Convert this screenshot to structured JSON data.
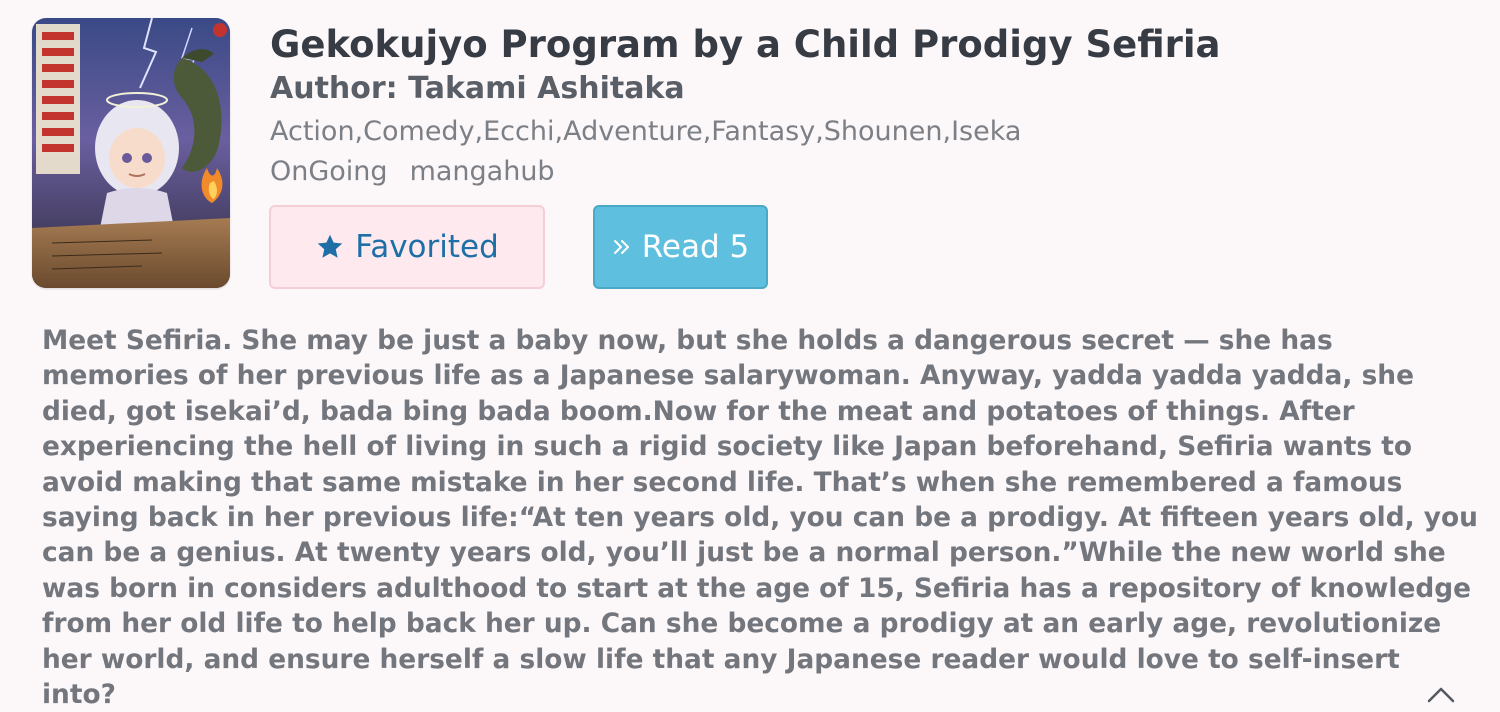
{
  "manga": {
    "title": "Gekokujyo Program by a Child Prodigy Sefiria",
    "author": "Author: Takami Ashitaka",
    "genres": "Action,Comedy,Ecchi,Adventure,Fantasy,Shounen,Iseka",
    "status": "OnGoing",
    "source": "mangahub",
    "cover_icon": "manga-cover-art"
  },
  "actions": {
    "favorite_label": "Favorited",
    "favorite_icon": "star-icon",
    "read_label": "Read 5",
    "read_icon": "double-chevron-right-icon"
  },
  "description": "Meet Sefiria. She may be just a baby now, but she holds a dangerous secret — she has memories of her previous life as a Japanese salarywoman. Anyway, yadda yadda yadda, she died, got isekai’d, bada bing bada boom.Now for the meat and potatoes of things. After experiencing the hell of living in such a rigid society like Japan beforehand, Sefiria wants to avoid making that same mistake in her second life. That’s when she remembered a famous saying back in her previous life:“At ten years old, you can be a prodigy. At fifteen years old, you can be a genius. At twenty years old, you’ll just be a normal person.”While the new world she was born in considers adulthood to start at the age of 15, Sefiria has a repository of knowledge from her old life to help back her up. Can she become a prodigy at an early age, revolutionize her world, and ensure herself a slow life that any Japanese reader would love to self-insert into?",
  "colors": {
    "background": "#fcf8fa",
    "favorite_bg": "#fde9ee",
    "favorite_text": "#1d6fa5",
    "read_bg": "#5ec0de",
    "read_text": "#ffffff"
  }
}
